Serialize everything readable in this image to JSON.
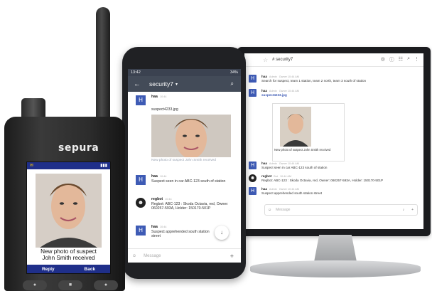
{
  "monitor": {
    "channel_title": "# security7",
    "messages": [
      {
        "sender": "haa",
        "role": "Admin",
        "meta": "Owner  10:44 AM",
        "text": "Search for suspect, team 1 station, team 2 north, team 3 south of station"
      },
      {
        "sender": "haa",
        "role": "Admin",
        "meta": "Owner  10:44 AM",
        "file": "suspect4233.jpg",
        "caption": "New photo of suspect John Smith received"
      },
      {
        "sender": "haa",
        "role": "Admin",
        "meta": "Owner  10:44 AM",
        "text": "Suspect seen in car ABC-123 south of station"
      },
      {
        "sender": "regbot",
        "role": "Bot",
        "meta": "10:44 AM",
        "text": "Regbot: ABC-123 : Skoda Octavia, red, Owner: 060257-593A, Holder: 150170-501P"
      },
      {
        "sender": "haa",
        "role": "Admin",
        "meta": "Owner  10:44 AM",
        "text": "Suspect apprehended south station street"
      }
    ],
    "input_placeholder": "Message"
  },
  "phone": {
    "status_time": "13:42",
    "status_right": "34%",
    "channel_title": "security7",
    "messages": [
      {
        "sender": "haa",
        "meta": "10:44"
      },
      {
        "file": "suspect4233.jpg",
        "caption": "New photo of suspect John Smith received"
      },
      {
        "sender": "haa",
        "meta": "10:44",
        "text": "Suspect seen in car ABC-123 south of station"
      },
      {
        "sender": "regbot",
        "meta": "10:44",
        "text": "Regbot: ABC-123 : Skoda Octavia, red, Owner: 060257-593A, Holder: 150170-501P"
      },
      {
        "sender": "haa",
        "meta": "10:44",
        "text": "Suspect apprehended south station street"
      }
    ],
    "input_placeholder": "Message"
  },
  "radio": {
    "brand": "sepura",
    "caption_line1": "New photo of suspect",
    "caption_line2": "John Smith received",
    "softkey_left": "Reply",
    "softkey_right": "Back"
  },
  "colors": {
    "accent": "#3e5bb5",
    "radio_bar": "#1f2f8a",
    "phone_header": "#434b58"
  }
}
